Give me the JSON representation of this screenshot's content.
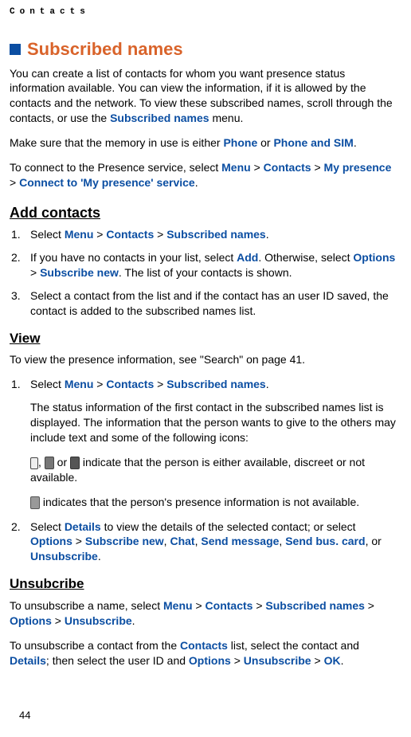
{
  "header": {
    "chapter": "Contacts"
  },
  "section": {
    "title": "Subscribed names"
  },
  "intro": {
    "p1a": "You can create a list of contacts for whom you want presence status information available. You can view the information, if it is allowed by the contacts and the network. To view these subscribed names, scroll through the contacts, or use the ",
    "p1b": "Subscribed names",
    "p1c": " menu.",
    "p2a": "Make sure that the memory in use is either ",
    "p2_phone": "Phone",
    "p2_or": " or ",
    "p2_phonesim": "Phone and SIM",
    "p2d": ".",
    "p3a": "To connect to the Presence service, select ",
    "menu": "Menu",
    "gt": " > ",
    "contacts": "Contacts",
    "mypresence": "My presence",
    "connect_service": "Connect to 'My presence' service",
    "period": "."
  },
  "add": {
    "heading": "Add contacts",
    "li1_a": "Select ",
    "li1_menu": "Menu",
    "li1_contacts": "Contacts",
    "li1_subnames": "Subscribed names",
    "li2_a": "If you have no contacts in your list, select ",
    "li2_add": "Add",
    "li2_b": ". Otherwise, select ",
    "li2_options": "Options",
    "li2_subnew": "Subscribe new",
    "li2_c": ". The list of your contacts is shown.",
    "li3": "Select a contact from the list and if the contact has an user ID saved, the contact is added to the subscribed names list."
  },
  "view": {
    "heading": "View",
    "intro": "To view the presence information, see \"Search\" on page 41.",
    "li1_a": "Select ",
    "li1_menu": "Menu",
    "li1_contacts": "Contacts",
    "li1_subnames": "Subscribed names",
    "li1_sub1": "The status information of the first contact in the subscribed names list is displayed. The information that the person wants to give to the others may include text and some of the following icons:",
    "li1_icons_mid": " indicate that the person is either available, discreet or not available.",
    "li1_icons_last": " indicates that the person's presence information is not available.",
    "comma": ", ",
    "or": " or ",
    "li2_a": "Select ",
    "li2_details": "Details",
    "li2_b": " to view the details of the selected contact; or select ",
    "li2_options": "Options",
    "li2_subnew": "Subscribe new",
    "li2_chat": "Chat",
    "li2_sendmsg": "Send message",
    "li2_sendcard": "Send bus. card",
    "li2_or": ", or ",
    "li2_unsub": "Unsubscribe",
    "li2_period": "."
  },
  "unsub": {
    "heading": "Unsubcribe",
    "p1a": "To unsubscribe a name, select ",
    "menu": "Menu",
    "contacts": "Contacts",
    "subnames": "Subscribed names",
    "options": "Options",
    "unsubscribe": "Unsubscribe",
    "p2a": "To unsubscribe a contact from the ",
    "p2b": " list, select the contact and ",
    "details": "Details",
    "p2c": "; then select the user ID and ",
    "ok": "OK",
    "period": "."
  },
  "page": {
    "number": "44"
  }
}
